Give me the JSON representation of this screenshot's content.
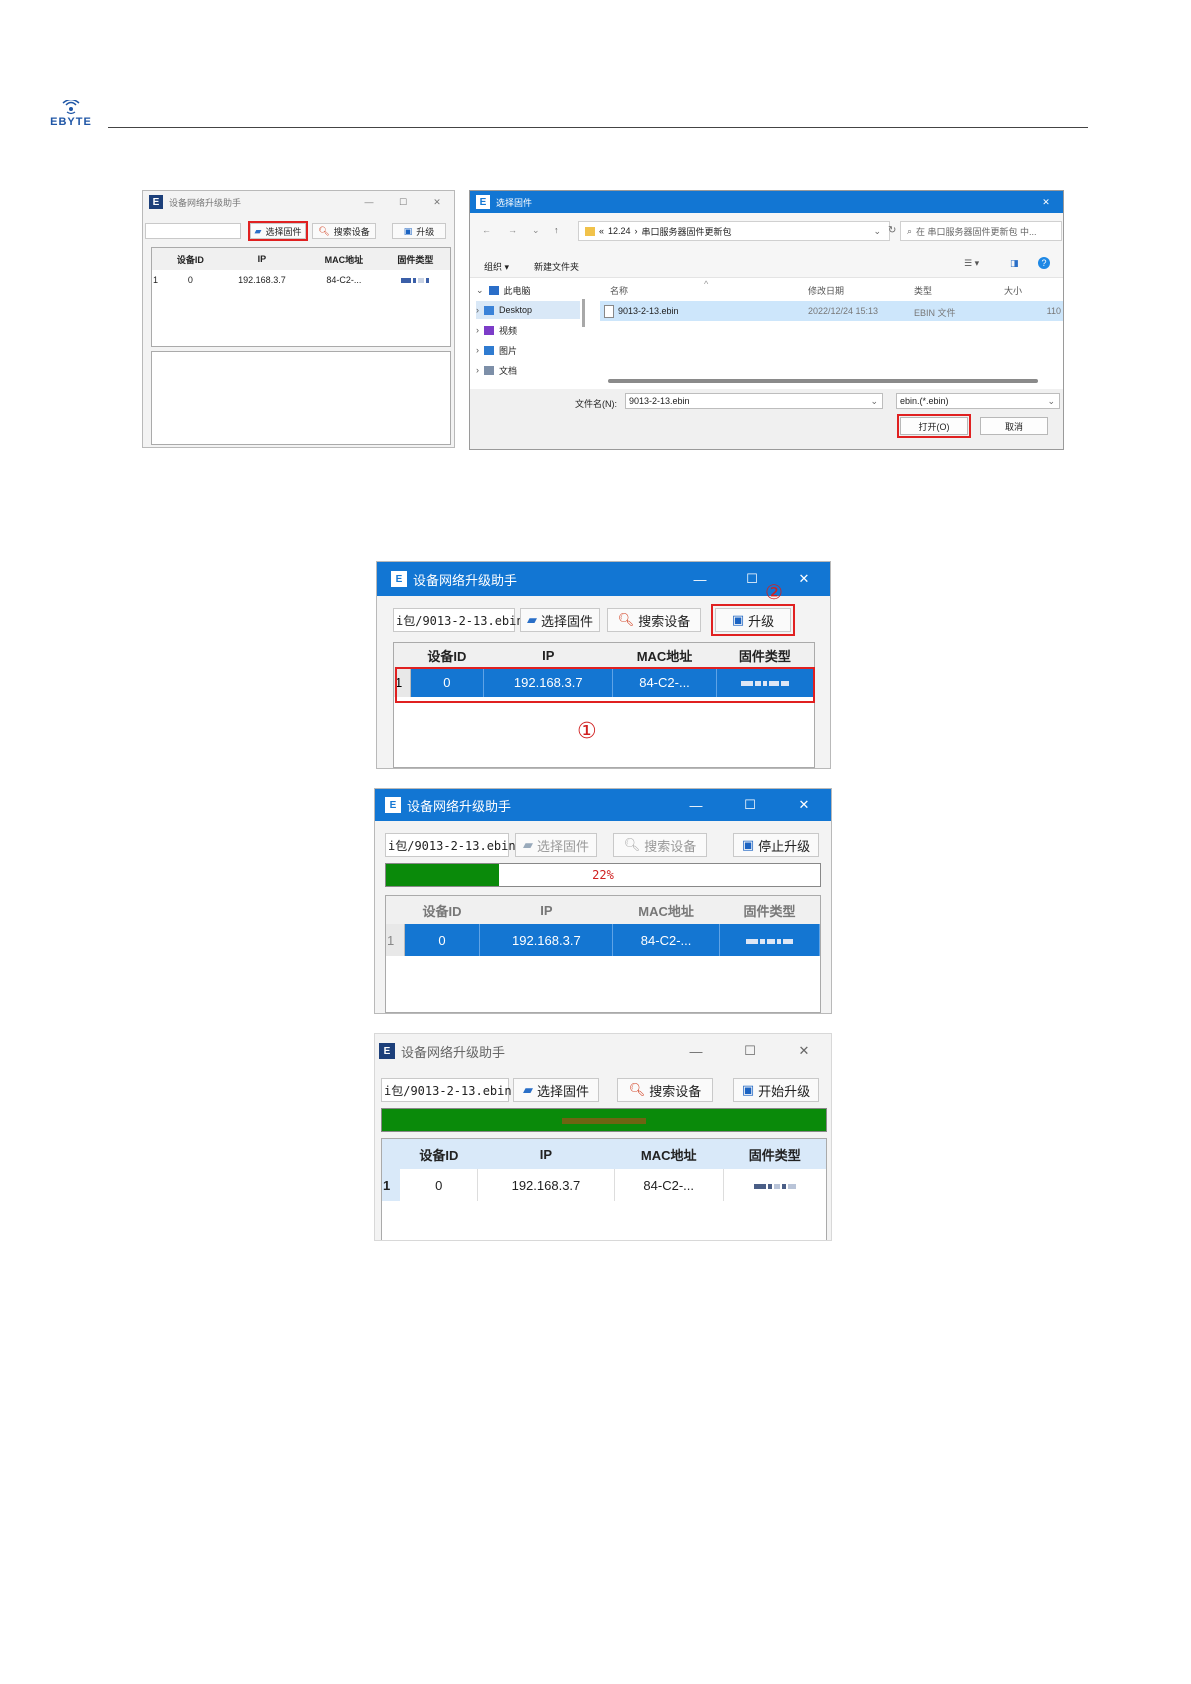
{
  "header": {
    "brand": "EBYTE"
  },
  "shot1": {
    "main": {
      "title": "设备网络升级助手",
      "min": "—",
      "max": "☐",
      "close": "✕",
      "btn_select": "选择固件",
      "btn_search": "搜索设备",
      "btn_upgrade": "升级",
      "columns": [
        "设备ID",
        "IP",
        "MAC地址",
        "固件类型"
      ],
      "row": {
        "num": "1",
        "id": "0",
        "ip": "192.168.3.7",
        "mac": "84-C2-..."
      }
    },
    "dialog": {
      "title": "选择固件",
      "close": "✕",
      "breadcrumb": [
        "«",
        "12.24",
        "›",
        "串口服务器固件更新包"
      ],
      "search_placeholder": "在 串口服务器固件更新包 中...",
      "toolbar": {
        "organize": "组织 ▾",
        "new_folder": "新建文件夹"
      },
      "nav": [
        "此电脑",
        "Desktop",
        "视频",
        "图片",
        "文档"
      ],
      "columns": [
        "名称",
        "修改日期",
        "类型",
        "大小"
      ],
      "file": {
        "name": "9013-2-13.ebin",
        "date": "2022/12/24 15:13",
        "type": "EBIN 文件",
        "size": "110"
      },
      "filename_label": "文件名(N):",
      "filename_value": "9013-2-13.ebin",
      "filter": "ebin.(*.ebin)",
      "open": "打开(O)",
      "cancel": "取消"
    }
  },
  "shot2": {
    "title": "设备网络升级助手",
    "min": "—",
    "max": "☐",
    "close": "✕",
    "path": "i包/9013-2-13.ebin",
    "btn_select": "选择固件",
    "btn_search": "搜索设备",
    "btn_upgrade": "升级",
    "marker_upgrade": "②",
    "marker_row": "①",
    "columns": [
      "设备ID",
      "IP",
      "MAC地址",
      "固件类型"
    ],
    "row": {
      "num": "1",
      "id": "0",
      "ip": "192.168.3.7",
      "mac": "84-C2-..."
    }
  },
  "shot3": {
    "title": "设备网络升级助手",
    "min": "—",
    "max": "☐",
    "close": "✕",
    "path": "i包/9013-2-13.ebin",
    "btn_select": "选择固件",
    "btn_search": "搜索设备",
    "btn_stop": "停止升级",
    "progress_text": "22%",
    "progress_value": 0.26,
    "columns": [
      "设备ID",
      "IP",
      "MAC地址",
      "固件类型"
    ],
    "row": {
      "num": "1",
      "id": "0",
      "ip": "192.168.3.7",
      "mac": "84-C2-..."
    }
  },
  "shot4": {
    "title": "设备网络升级助手",
    "min": "—",
    "max": "☐",
    "close": "✕",
    "path": "i包/9013-2-13.ebin",
    "btn_select": "选择固件",
    "btn_search": "搜索设备",
    "btn_start": "开始升级",
    "progress_value": 1.0,
    "columns": [
      "设备ID",
      "IP",
      "MAC地址",
      "固件类型"
    ],
    "row": {
      "num": "1",
      "id": "0",
      "ip": "192.168.3.7",
      "mac": "84-C2-..."
    }
  }
}
